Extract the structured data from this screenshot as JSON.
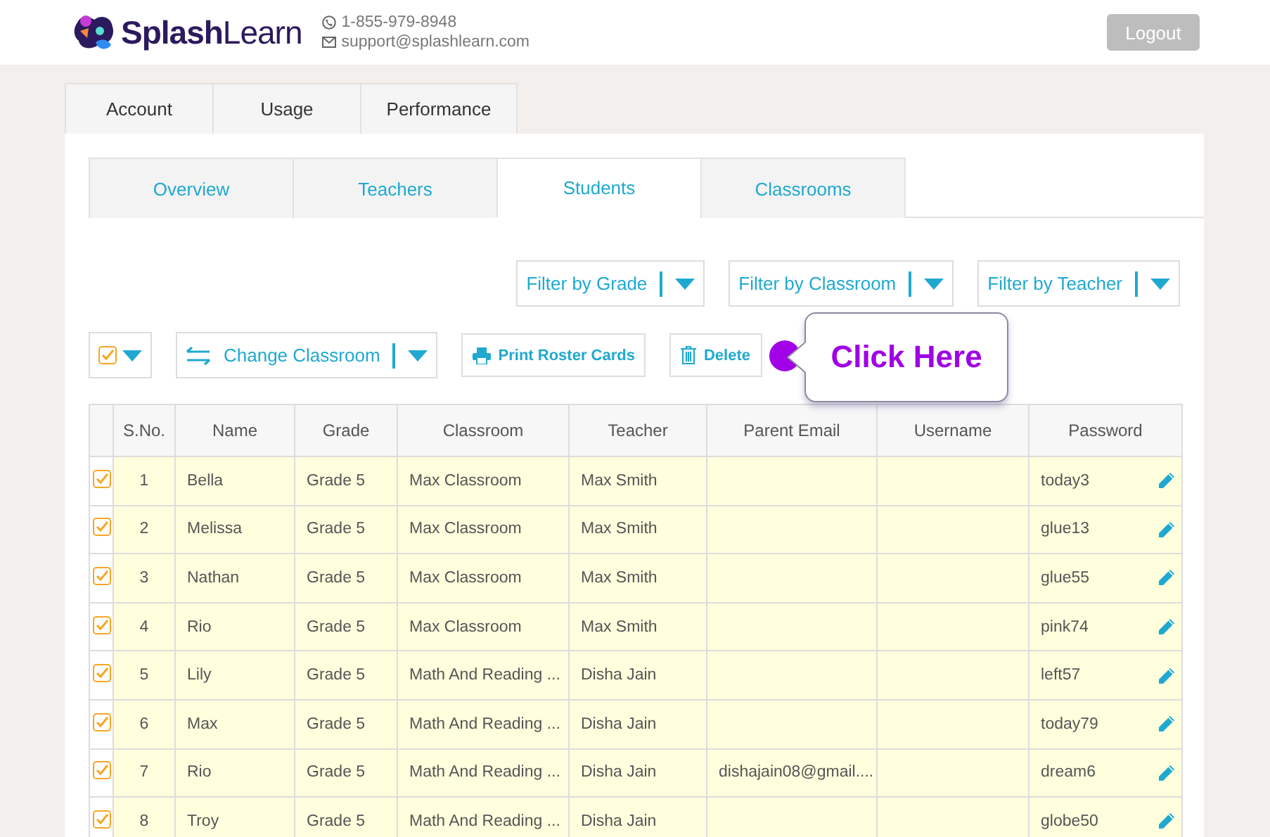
{
  "header": {
    "logo": "**Splash**Learn",
    "phone": "1-855-979-8948",
    "email": "support@splashlearn.com",
    "logout": "Logout"
  },
  "account_tabs": [
    {
      "label": "Account"
    },
    {
      "label": "Usage"
    },
    {
      "label": "Performance"
    }
  ],
  "section_tabs": [
    {
      "label": "Overview",
      "selected": false
    },
    {
      "label": "Teachers",
      "selected": false
    },
    {
      "label": "Students",
      "selected": true
    },
    {
      "label": "Classrooms",
      "selected": false
    }
  ],
  "filters": [
    "Filter by Grade",
    "Filter by Classroom",
    "Filter by Teacher"
  ],
  "actions": {
    "select_all_checked": true,
    "change_classroom": "Change Classroom",
    "print": "Print Roster Cards",
    "delete": "Delete"
  },
  "callout": {
    "text": "Click Here"
  },
  "table": {
    "columns": [
      "S.No.",
      "Name",
      "Grade",
      "Classroom",
      "Teacher",
      "Parent Email",
      "Username",
      "Password"
    ],
    "rows": [
      {
        "checked": true,
        "cells": [
          "1",
          "Bella",
          "Grade 5",
          "Max Classroom",
          "Max Smith",
          "",
          "",
          "today3"
        ]
      },
      {
        "checked": true,
        "cells": [
          "2",
          "Melissa",
          "Grade 5",
          "Max Classroom",
          "Max Smith",
          "",
          "",
          "glue13"
        ]
      },
      {
        "checked": true,
        "cells": [
          "3",
          "Nathan",
          "Grade 5",
          "Max Classroom",
          "Max Smith",
          "",
          "",
          "glue55"
        ]
      },
      {
        "checked": true,
        "cells": [
          "4",
          "Rio",
          "Grade 5",
          "Max Classroom",
          "Max Smith",
          "",
          "",
          "pink74"
        ]
      },
      {
        "checked": true,
        "cells": [
          "5",
          "Lily",
          "Grade 5",
          "Math And Reading ...",
          "Disha Jain",
          "",
          "",
          "left57"
        ]
      },
      {
        "checked": true,
        "cells": [
          "6",
          "Max",
          "Grade 5",
          "Math And Reading ...",
          "Disha Jain",
          "",
          "",
          "today79"
        ]
      },
      {
        "checked": true,
        "cells": [
          "7",
          "Rio",
          "Grade 5",
          "Math And Reading ...",
          "Disha Jain",
          "dishajain08@gmail....",
          "",
          "dream6"
        ]
      },
      {
        "checked": true,
        "cells": [
          "8",
          "Troy",
          "Grade 5",
          "Math And Reading ...",
          "Disha Jain",
          "",
          "",
          "globe50"
        ]
      }
    ]
  }
}
